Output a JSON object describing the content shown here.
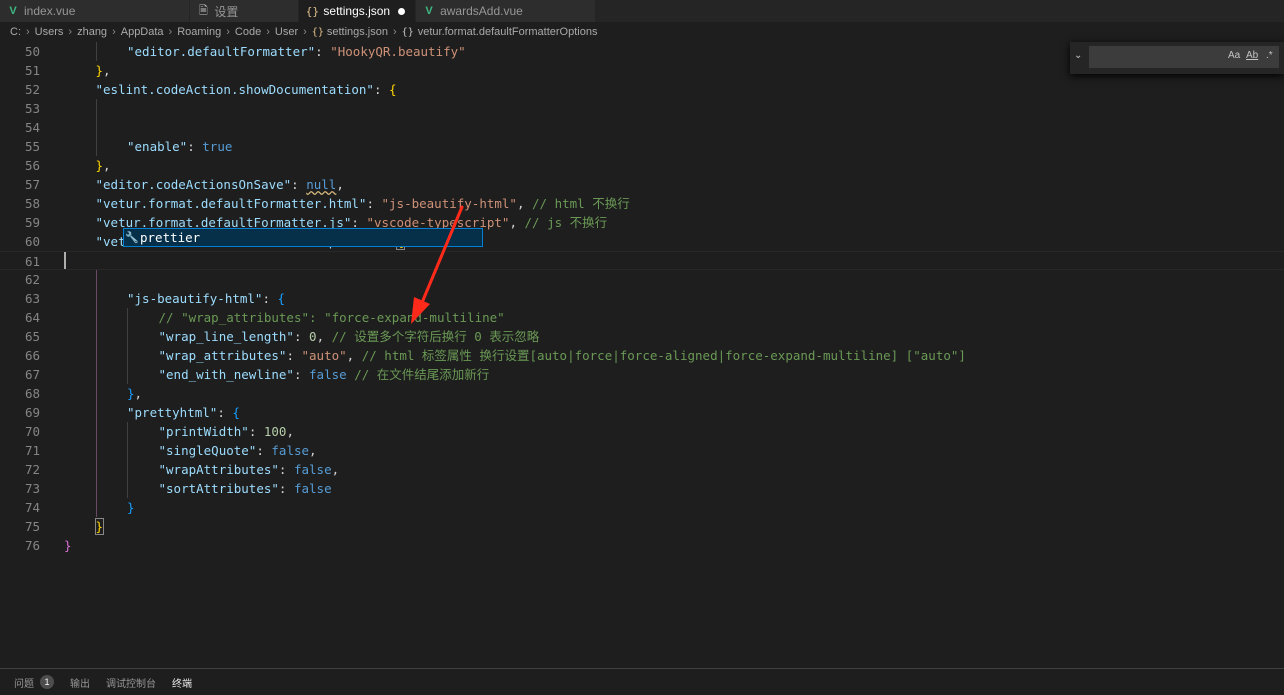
{
  "tabs": [
    {
      "label": "index.vue",
      "icon": "vue-icon"
    },
    {
      "label": "设置",
      "icon": "file-icon"
    },
    {
      "label": "settings.json",
      "icon": "json-icon"
    },
    {
      "label": "awardsAdd.vue",
      "icon": "vue-icon"
    }
  ],
  "breadcrumb": [
    "C:",
    "Users",
    "zhang",
    "AppData",
    "Roaming",
    "Code",
    "User",
    "settings.json",
    "vetur.format.defaultFormatterOptions"
  ],
  "find": {
    "placeholder": "",
    "opt_case": "Aa",
    "opt_word": "Ab",
    "opt_regex": ".*"
  },
  "suggest": {
    "label": "prettier"
  },
  "lines": [
    {
      "n": "50",
      "t": [
        [
          "k",
          "\"editor.defaultFormatter\""
        ],
        [
          "p",
          ": "
        ],
        [
          "s",
          "\"HookyQR.beautify\""
        ]
      ],
      "i": 2
    },
    {
      "n": "51",
      "t": [
        [
          "br2",
          "}"
        ],
        [
          "p",
          ","
        ]
      ],
      "i": 1
    },
    {
      "n": "52",
      "t": [
        [
          "k",
          "\"eslint.codeAction.showDocumentation\""
        ],
        [
          "p",
          ": "
        ],
        [
          "br2",
          "{"
        ]
      ],
      "i": 1
    },
    {
      "n": "53",
      "t": [],
      "i": 0
    },
    {
      "n": "54",
      "t": [],
      "i": 0
    },
    {
      "n": "55",
      "t": [
        [
          "k",
          "\"enable\""
        ],
        [
          "p",
          ": "
        ],
        [
          "b",
          "true"
        ]
      ],
      "i": 2
    },
    {
      "n": "56",
      "t": [
        [
          "br2",
          "}"
        ],
        [
          "p",
          ","
        ]
      ],
      "i": 1
    },
    {
      "n": "57",
      "t": [
        [
          "k",
          "\"editor.codeActionsOnSave\""
        ],
        [
          "p",
          ": "
        ],
        [
          "b",
          "null"
        ],
        [
          "p",
          ","
        ]
      ],
      "i": 1
    },
    {
      "n": "58",
      "t": [
        [
          "k",
          "\"vetur.format.defaultFormatter.html\""
        ],
        [
          "p",
          ": "
        ],
        [
          "s",
          "\"js-beautify-html\""
        ],
        [
          "p",
          ", "
        ],
        [
          "c",
          "// html 不换行"
        ]
      ],
      "i": 1
    },
    {
      "n": "59",
      "t": [
        [
          "k",
          "\"vetur.format.defaultFormatter.js\""
        ],
        [
          "p",
          ": "
        ],
        [
          "s",
          "\"vscode-typescript\""
        ],
        [
          "p",
          ", "
        ],
        [
          "c",
          "// js 不换行"
        ]
      ],
      "i": 1
    },
    {
      "n": "60",
      "t": [
        [
          "k",
          "\"vetur.format.defaultFormatterOptions\""
        ],
        [
          "p",
          ": "
        ],
        [
          "br2",
          "{"
        ]
      ],
      "i": 1
    },
    {
      "n": "61",
      "t": [],
      "i": 0
    },
    {
      "n": "62",
      "t": [],
      "i": 0
    },
    {
      "n": "63",
      "t": [
        [
          "k",
          "\"js-beautify-html\""
        ],
        [
          "p",
          ": "
        ],
        [
          "br3",
          "{"
        ]
      ],
      "i": 2
    },
    {
      "n": "64",
      "t": [
        [
          "c",
          "// \"wrap_attributes\": \"force-expand-multiline\""
        ]
      ],
      "i": 3
    },
    {
      "n": "65",
      "t": [
        [
          "k",
          "\"wrap_line_length\""
        ],
        [
          "p",
          ": "
        ],
        [
          "n",
          "0"
        ],
        [
          "p",
          ", "
        ],
        [
          "c",
          "// 设置多个字符后换行 0 表示忽略"
        ]
      ],
      "i": 3
    },
    {
      "n": "66",
      "t": [
        [
          "k",
          "\"wrap_attributes\""
        ],
        [
          "p",
          ": "
        ],
        [
          "s",
          "\"auto\""
        ],
        [
          "p",
          ", "
        ],
        [
          "c",
          "// html 标签属性 换行设置[auto|force|force-aligned|force-expand-multiline] [\"auto\"]"
        ]
      ],
      "i": 3
    },
    {
      "n": "67",
      "t": [
        [
          "k",
          "\"end_with_newline\""
        ],
        [
          "p",
          ": "
        ],
        [
          "b",
          "false"
        ],
        [
          "p",
          " "
        ],
        [
          "c",
          "// 在文件结尾添加新行"
        ]
      ],
      "i": 3
    },
    {
      "n": "68",
      "t": [
        [
          "br3",
          "}"
        ],
        [
          "p",
          ","
        ]
      ],
      "i": 2
    },
    {
      "n": "69",
      "t": [
        [
          "k",
          "\"prettyhtml\""
        ],
        [
          "p",
          ": "
        ],
        [
          "br3",
          "{"
        ]
      ],
      "i": 2
    },
    {
      "n": "70",
      "t": [
        [
          "k",
          "\"printWidth\""
        ],
        [
          "p",
          ": "
        ],
        [
          "n",
          "100"
        ],
        [
          "p",
          ","
        ]
      ],
      "i": 3
    },
    {
      "n": "71",
      "t": [
        [
          "k",
          "\"singleQuote\""
        ],
        [
          "p",
          ": "
        ],
        [
          "b",
          "false"
        ],
        [
          "p",
          ","
        ]
      ],
      "i": 3
    },
    {
      "n": "72",
      "t": [
        [
          "k",
          "\"wrapAttributes\""
        ],
        [
          "p",
          ": "
        ],
        [
          "b",
          "false"
        ],
        [
          "p",
          ","
        ]
      ],
      "i": 3
    },
    {
      "n": "73",
      "t": [
        [
          "k",
          "\"sortAttributes\""
        ],
        [
          "p",
          ": "
        ],
        [
          "b",
          "false"
        ]
      ],
      "i": 3
    },
    {
      "n": "74",
      "t": [
        [
          "br3",
          "}"
        ]
      ],
      "i": 2
    },
    {
      "n": "75",
      "t": [
        [
          "br2",
          "}"
        ]
      ],
      "i": 1
    },
    {
      "n": "76",
      "t": [
        [
          "br1",
          "}"
        ]
      ],
      "i": 0
    }
  ],
  "panel": {
    "tabs": [
      {
        "label": "问题",
        "badge": "1"
      },
      {
        "label": "输出"
      },
      {
        "label": "调试控制台"
      },
      {
        "label": "终端"
      }
    ]
  },
  "colors": {
    "accent": "#007fd4",
    "annotation_arrow": "#ff2a1a",
    "background": "#1e1e1e"
  }
}
